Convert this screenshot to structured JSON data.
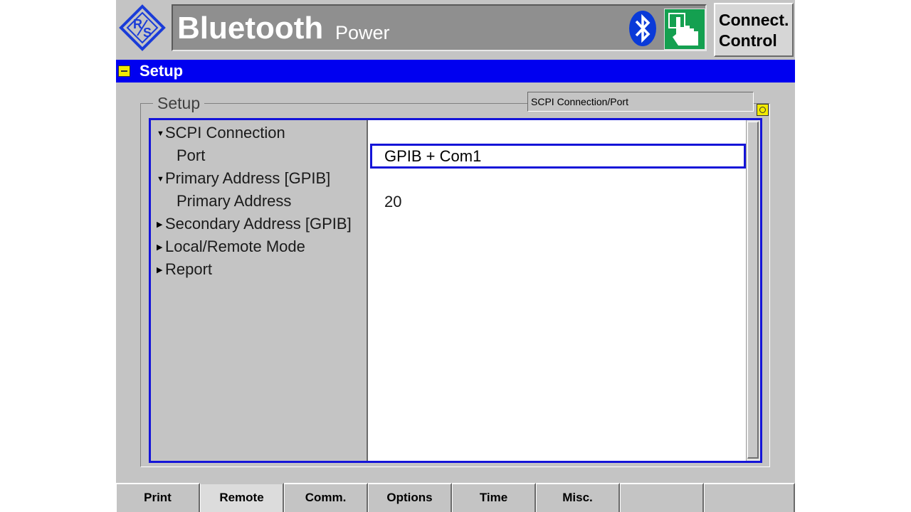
{
  "header": {
    "app_title": "Bluetooth",
    "subtitle": "Power",
    "connect_button": "Connect.\nControl"
  },
  "section": {
    "title": "Setup"
  },
  "group": {
    "label": "Setup",
    "path": "SCPI Connection/Port"
  },
  "tree": {
    "items": [
      {
        "label": "SCPI Connection",
        "expanded": true
      },
      {
        "label": "Port"
      },
      {
        "label": "Primary Address [GPIB]",
        "expanded": true
      },
      {
        "label": "Primary Address"
      },
      {
        "label": "Secondary Address [GPIB]",
        "expanded": false
      },
      {
        "label": "Local/Remote Mode",
        "expanded": false
      },
      {
        "label": "Report",
        "expanded": false
      }
    ]
  },
  "values": {
    "port": "GPIB + Com1",
    "primary_address": "20"
  },
  "softkeys": [
    {
      "label": "Print"
    },
    {
      "label": "Remote",
      "active": true
    },
    {
      "label": "Comm."
    },
    {
      "label": "Options"
    },
    {
      "label": "Time"
    },
    {
      "label": "Misc."
    },
    {
      "label": ""
    },
    {
      "label": ""
    }
  ],
  "icons": {
    "logo": "rohde-schwarz-logo",
    "bluetooth": "bluetooth-icon",
    "hand": "hand-pointer-icon",
    "section_marker": "minus-square-icon",
    "refresh": "refresh-icon"
  },
  "colors": {
    "accent_blue": "#0000f0",
    "panel_grey": "#c4c4c4",
    "marker_yellow": "#f2ea00",
    "hand_green": "#14a050"
  }
}
